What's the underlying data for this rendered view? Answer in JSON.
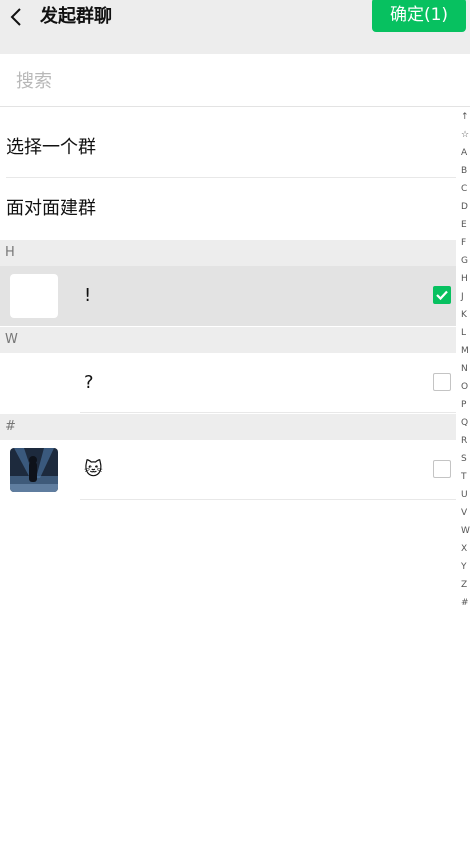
{
  "header": {
    "title": "发起群聊",
    "confirm_label": "确定(1)"
  },
  "search": {
    "placeholder": "搜索",
    "value": ""
  },
  "options": [
    {
      "label": "选择一个群"
    },
    {
      "label": "面对面建群"
    }
  ],
  "sections": [
    {
      "letter": "H",
      "contacts": [
        {
          "name": "!",
          "checked": true
        }
      ]
    },
    {
      "letter": "W",
      "contacts": [
        {
          "name": "?",
          "checked": false
        }
      ]
    },
    {
      "letter": "#",
      "contacts": [
        {
          "name": "🐱",
          "checked": false
        }
      ]
    }
  ],
  "index_letters": [
    "↑",
    "☆",
    "A",
    "B",
    "C",
    "D",
    "E",
    "F",
    "G",
    "H",
    "J",
    "K",
    "L",
    "M",
    "N",
    "O",
    "P",
    "Q",
    "R",
    "S",
    "T",
    "U",
    "V",
    "W",
    "X",
    "Y",
    "Z",
    "#"
  ],
  "colors": {
    "accent": "#07c160",
    "header_bg": "#ededed",
    "section_bg": "#ededed",
    "selected_row_bg": "#e3e3e3"
  }
}
